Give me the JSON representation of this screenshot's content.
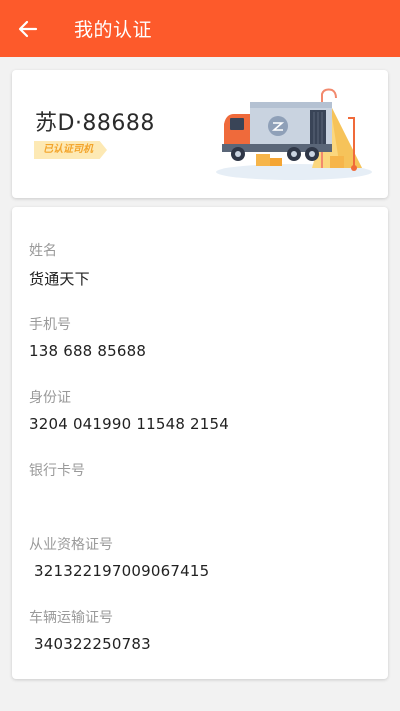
{
  "appbar": {
    "title": "我的认证",
    "back_icon": "arrow-left-icon",
    "color": "#fd5a2b"
  },
  "vehicle": {
    "plate": "苏D·88688",
    "badge": "已认证司机"
  },
  "fields": [
    {
      "label": "姓名",
      "value": "货通天下"
    },
    {
      "label": "手机号",
      "value": "138 688 85688"
    },
    {
      "label": "身份证",
      "value": "3204 041990 11548 2154"
    },
    {
      "label": "银行卡号",
      "value": ""
    },
    {
      "label": "从业资格证号",
      "value": " 321322197009067415"
    },
    {
      "label": "车辆运输证号",
      "value": " 340322250783"
    }
  ]
}
